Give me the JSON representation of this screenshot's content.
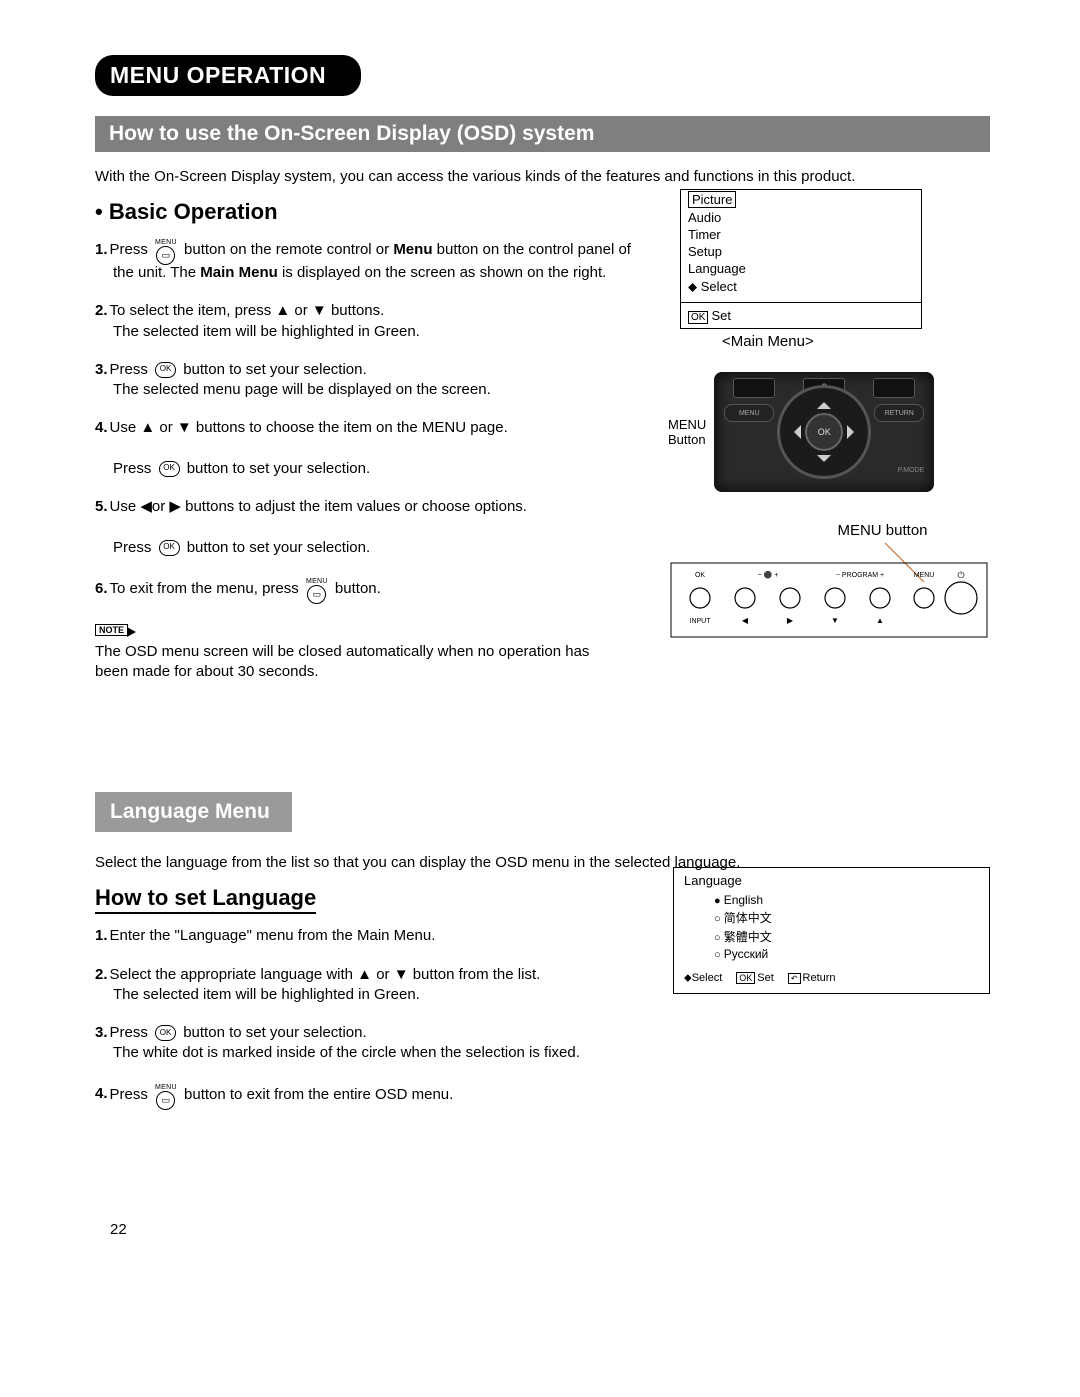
{
  "page_number": "22",
  "section_title": "MENU OPERATION",
  "bar1": "How to use the On-Screen Display (OSD) system",
  "intro": "With the On-Screen Display system, you can access the various kinds of the features and functions in this product.",
  "sub_heading": "Basic Operation",
  "steps": {
    "s1a": "Press ",
    "s1b": " button on the remote control or ",
    "s1c": "Menu",
    "s1d": " button on the control panel of the unit. The ",
    "s1e": "Main Menu",
    "s1f": " is displayed on the screen as shown on the right.",
    "s2a": "To select the item, press ▲ or ▼ buttons.",
    "s2b": "The selected item will be highlighted in Green.",
    "s3a": "Press ",
    "s3b": " button to set your selection.",
    "s3c": "The selected menu page will be displayed on the screen.",
    "s4a": "Use ▲ or ▼ buttons to choose the item on the MENU page.",
    "s4b": "Press ",
    "s4c": " button to set your selection.",
    "s5a": "Use ◀or ▶ buttons to adjust the item values or choose options.",
    "s5b": "Press ",
    "s5c": " button to set your selection.",
    "s6a": "To exit from the menu, press ",
    "s6b": " button."
  },
  "note_label": "NOTE",
  "note_text": "The OSD menu screen will be closed automatically when no operation has been made for about 30 seconds.",
  "osd_menu": {
    "items": [
      "Picture",
      "Audio",
      "Timer",
      "Setup",
      "Language"
    ],
    "select_hint": "Select",
    "set_hint": "Set",
    "ok": "OK",
    "caption": "<Main Menu>"
  },
  "remote": {
    "label_line1": "MENU",
    "label_line2": "Button",
    "ok": "OK",
    "menu": "MENU",
    "return": "RETURN",
    "pmode": "P.MODE",
    "zero": "0"
  },
  "panel": {
    "caption": "MENU button",
    "labels": {
      "ok": "OK",
      "minus": "−",
      "plus": "+",
      "prog": "— PROGRAM +",
      "menu": "MENU",
      "power": "⏻",
      "input": "INPUT",
      "left": "◀",
      "right": "▶",
      "down": "▼",
      "up": "▲",
      "vol": "— ⚫ +"
    }
  },
  "bar2": "Language Menu",
  "lang_intro": "Select the language from the list so that you can display the OSD menu in the selected language.",
  "lang_heading": "How to set Language",
  "lang_steps": {
    "l1": "Enter the \"Language\" menu from the Main Menu.",
    "l2a": "Select the appropriate language with ▲ or ▼ button from the list.",
    "l2b": "The selected item will be highlighted in Green.",
    "l3a": "Press ",
    "l3b": " button to set your selection.",
    "l3c": "The white dot is marked inside of the circle when the selection is fixed.",
    "l4a": "Press ",
    "l4b": " button to exit from the entire OSD menu."
  },
  "lang_osd": {
    "title": "Language",
    "options": [
      "English",
      "简体中文",
      "繁體中文",
      "Русский"
    ],
    "select": "Select",
    "set": "Set",
    "return": "Return",
    "ok": "OK"
  },
  "icon_labels": {
    "menu": "MENU",
    "ok": "OK"
  }
}
